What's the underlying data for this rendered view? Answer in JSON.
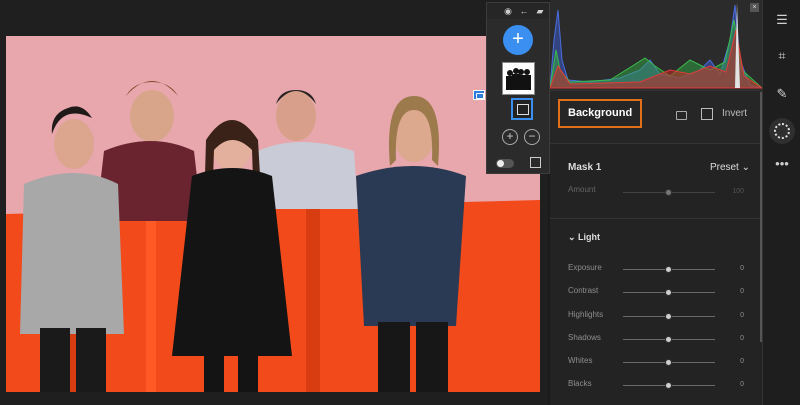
{
  "mask_popup": {
    "add_symbol": "+",
    "add_mask_symbol": "+",
    "subtract_mask_symbol": "−",
    "header_icons": [
      "eye-icon",
      "arrow-left-icon",
      "pin-icon"
    ]
  },
  "selection": {
    "section_label": "Background",
    "invert_label": "Invert"
  },
  "mask": {
    "name": "Mask 1",
    "preset_label": "Preset ⌄",
    "amount_label": "Amount",
    "amount_value": "100"
  },
  "light": {
    "title": "Light",
    "rows": [
      {
        "label": "Exposure",
        "value": "0"
      },
      {
        "label": "Contrast",
        "value": "0"
      },
      {
        "label": "Highlights",
        "value": "0"
      },
      {
        "label": "Shadows",
        "value": "0"
      },
      {
        "label": "Whites",
        "value": "0"
      },
      {
        "label": "Blacks",
        "value": "0"
      }
    ]
  },
  "toolbar": {
    "tools": [
      "sliders-icon",
      "crop-icon",
      "healing-icon",
      "masking-icon",
      "more-icon"
    ],
    "active": "masking-icon"
  },
  "colors": {
    "accent": "#3a8ff0",
    "selection_outline": "#e1701a",
    "backdrop_pink": "#e8a6ad",
    "backdrop_orange": "#f24a1b"
  }
}
